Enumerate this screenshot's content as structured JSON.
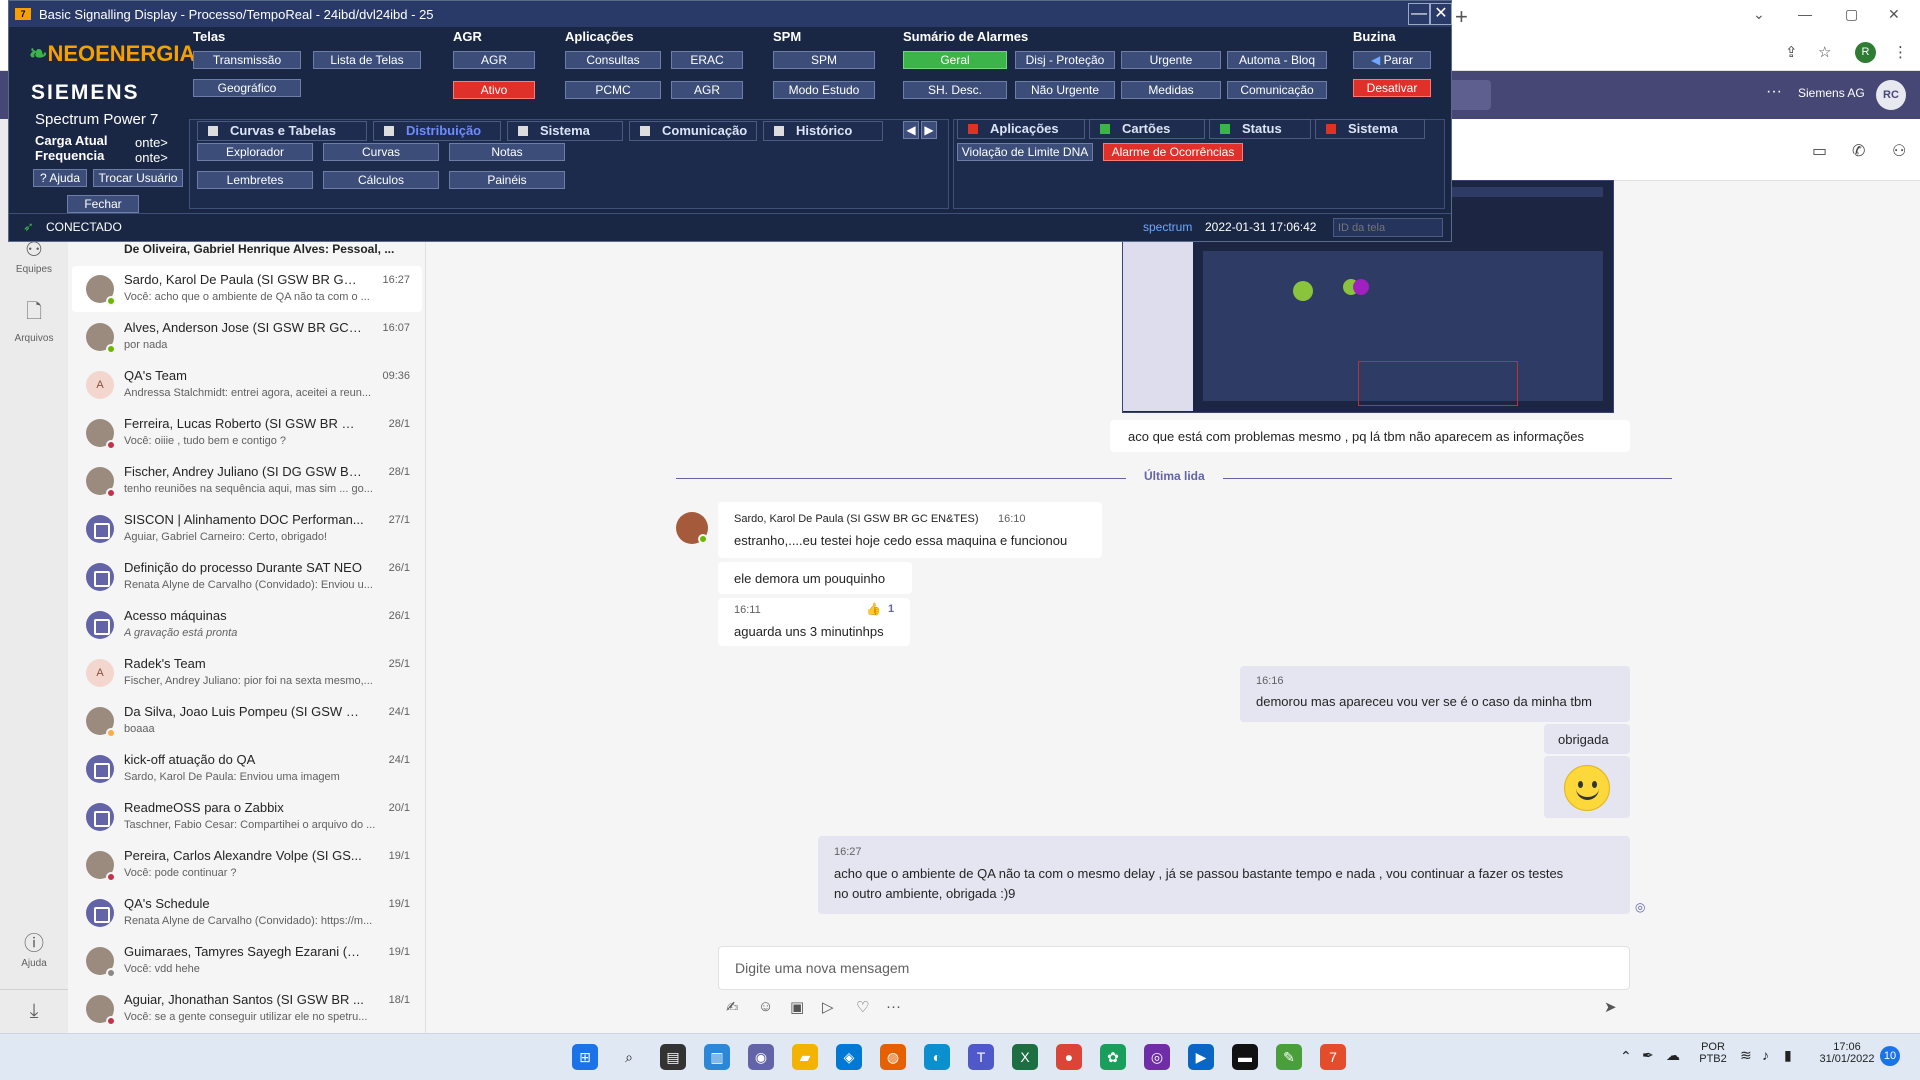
{
  "browser": {
    "new_tab": "+",
    "min": "—",
    "restore": "▢",
    "close": "✕",
    "profile_initial": "R"
  },
  "teams": {
    "org": "Siemens AG",
    "avatar": "RC",
    "app_bar": [
      {
        "label": "Equipes",
        "icon": "teams-icon"
      },
      {
        "label": "Arquivos",
        "icon": "files-icon"
      },
      {
        "label": "Ajuda",
        "icon": "help-icon"
      }
    ],
    "top_truncated": "De Oliveira, Gabriel Henrique Alves: Pessoal, ...",
    "chats": [
      {
        "name": "Sardo, Karol De Paula (SI GSW BR GC ...",
        "time": "16:27",
        "preview": "Você: acho que o ambiente de QA não ta com o ...",
        "status": "#6bb700",
        "avatar": "",
        "selected": true
      },
      {
        "name": "Alves, Anderson Jose (SI GSW BR GC E...",
        "time": "16:07",
        "preview": "por nada",
        "status": "#6bb700",
        "avatar": ""
      },
      {
        "name": "QA's Team",
        "time": "09:36",
        "preview": "Andressa Stalchmidt: entrei agora, aceitei a reun...",
        "status": "",
        "avatar": "A",
        "initials": true
      },
      {
        "name": "Ferreira, Lucas Roberto (SI GSW BR GC ...",
        "time": "28/1",
        "preview": "Você: oiiie , tudo bem e contigo ?",
        "status": "#c4314b",
        "avatar": ""
      },
      {
        "name": "Fischer, Andrey Juliano (SI DG GSW BR ...",
        "time": "28/1",
        "preview": "tenho reuniões na sequência aqui, mas sim ... go...",
        "status": "#c4314b",
        "avatar": ""
      },
      {
        "name": "SISCON | Alinhamento DOC Performan...",
        "time": "27/1",
        "preview": "Aguiar, Gabriel Carneiro: Certo, obrigado!",
        "status": "",
        "avatar": "",
        "group": true
      },
      {
        "name": "Definição do processo Durante SAT NEO",
        "time": "26/1",
        "preview": "Renata Alyne de Carvalho (Convidado): Enviou u...",
        "status": "",
        "avatar": "",
        "group": true
      },
      {
        "name": "Acesso máquinas",
        "time": "26/1",
        "preview": "A gravação está pronta",
        "status": "",
        "avatar": "",
        "group": true,
        "italic": true
      },
      {
        "name": "Radek's Team",
        "time": "25/1",
        "preview": "Fischer, Andrey Juliano: pior foi na sexta mesmo,...",
        "status": "",
        "avatar": "A",
        "initials": true
      },
      {
        "name": "Da Silva, Joao Luis Pompeu (SI GSW BR...",
        "time": "24/1",
        "preview": "boaaa",
        "status": "#ffaa44",
        "avatar": ""
      },
      {
        "name": "kick-off atuação do QA",
        "time": "24/1",
        "preview": "Sardo, Karol De Paula: Enviou uma imagem",
        "status": "",
        "avatar": "",
        "group": true
      },
      {
        "name": "ReadmeOSS para o Zabbix",
        "time": "20/1",
        "preview": "Taschner, Fabio Cesar: Compartihei o arquivo do ...",
        "status": "",
        "avatar": "",
        "group": true
      },
      {
        "name": "Pereira, Carlos Alexandre Volpe (SI GS...",
        "time": "19/1",
        "preview": "Você: pode continuar ?",
        "status": "#c4314b",
        "avatar": ""
      },
      {
        "name": "QA's Schedule",
        "time": "19/1",
        "preview": "Renata Alyne de Carvalho (Convidado): https://m...",
        "status": "",
        "avatar": "",
        "group": true
      },
      {
        "name": "Guimaraes, Tamyres Sayegh Ezarani (ex...",
        "time": "19/1",
        "preview": "Você: vdd hehe",
        "status": "#8a8886",
        "avatar": ""
      },
      {
        "name": "Aguiar, Jhonathan Santos (SI GSW BR ...",
        "time": "18/1",
        "preview": "Você: se a gente conseguir utilizar ele no spetru...",
        "status": "#c4314b",
        "avatar": ""
      }
    ],
    "messages": {
      "caption": "aco que está com problemas mesmo , pq lá tbm não aparecem as informações",
      "last_read": "Última lida",
      "sender": "Sardo, Karol De Paula (SI GSW BR GC EN&TES)",
      "sender_time": "16:10",
      "m1": "estranho,....eu testei hoje cedo essa maquina e funcionou",
      "m2": "ele demora um pouquinho",
      "m3_time": "16:11",
      "m3_reaction": "1",
      "m3": "aguarda uns 3 minutinhps",
      "me1_time": "16:16",
      "me1": "demorou mas apareceu vou ver se é o caso da minha tbm",
      "me2": "obrigada",
      "me3_time": "16:27",
      "me3a": "acho que o ambiente de QA não ta com o mesmo delay , já se passou bastante tempo e nada , vou continuar a fazer os testes",
      "me3b": "no outro ambiente, obrigada :)9"
    },
    "compose_placeholder": "Digite uma nova mensagem"
  },
  "signalling": {
    "title": "Basic Signalling Display - Processo/TempoReal - 24ibd/dvl24ibd - 25",
    "logo_badge": "7",
    "brand": "NEOENERGIA",
    "vendor": "SIEMENS",
    "product": "Spectrum Power 7",
    "carga_label": "Carga Atual",
    "freq_label": "Frequencia",
    "carga_val": "onte>",
    "freq_val": "onte>",
    "sections": {
      "telas": "Telas",
      "agr": "AGR",
      "aplicacoes": "Aplicações",
      "spm": "SPM",
      "alarmes": "Sumário de Alarmes",
      "buzina": "Buzina"
    },
    "buttons": {
      "transmissao": "Transmissão",
      "lista_telas": "Lista de Telas",
      "geografico": "Geográfico",
      "agr": "AGR",
      "ativo": "Ativo",
      "consultas": "Consultas",
      "erac": "ERAC",
      "pcmc": "PCMC",
      "agr2": "AGR",
      "spm": "SPM",
      "modo_estudo": "Modo Estudo",
      "geral": "Geral",
      "disj": "Disj - Proteção",
      "urgente": "Urgente",
      "automa": "Automa - Bloq",
      "sh_desc": "SH. Desc.",
      "nao_urgente": "Não Urgente",
      "medidas": "Medidas",
      "comunicacao": "Comunicação",
      "parar": "Parar",
      "desativar": "Desativar",
      "ajuda": "Ajuda",
      "trocar": "Trocar Usuário",
      "fechar": "Fechar",
      "explorador": "Explorador",
      "curvas": "Curvas",
      "notas": "Notas",
      "lembretes": "Lembretes",
      "calculos": "Cálculos",
      "paineis": "Painéis",
      "violacao": "Violação de Limite DNA",
      "alarme_ocorr": "Alarme de Ocorrências"
    },
    "tabs_left": [
      "Curvas e Tabelas",
      "Distribuição",
      "Sistema",
      "Comunicação",
      "Histórico"
    ],
    "tabs_right": [
      "Aplicações",
      "Cartões",
      "Status",
      "Sistema"
    ],
    "status_text": "CONECTADO",
    "server": "spectrum",
    "datetime": "2022-01-31 17:06:42",
    "id_placeholder": "ID da tela"
  },
  "taskbar": {
    "lang1": "POR",
    "lang2": "PTB2",
    "time": "17:06",
    "date": "31/01/2022",
    "badge": "10"
  }
}
